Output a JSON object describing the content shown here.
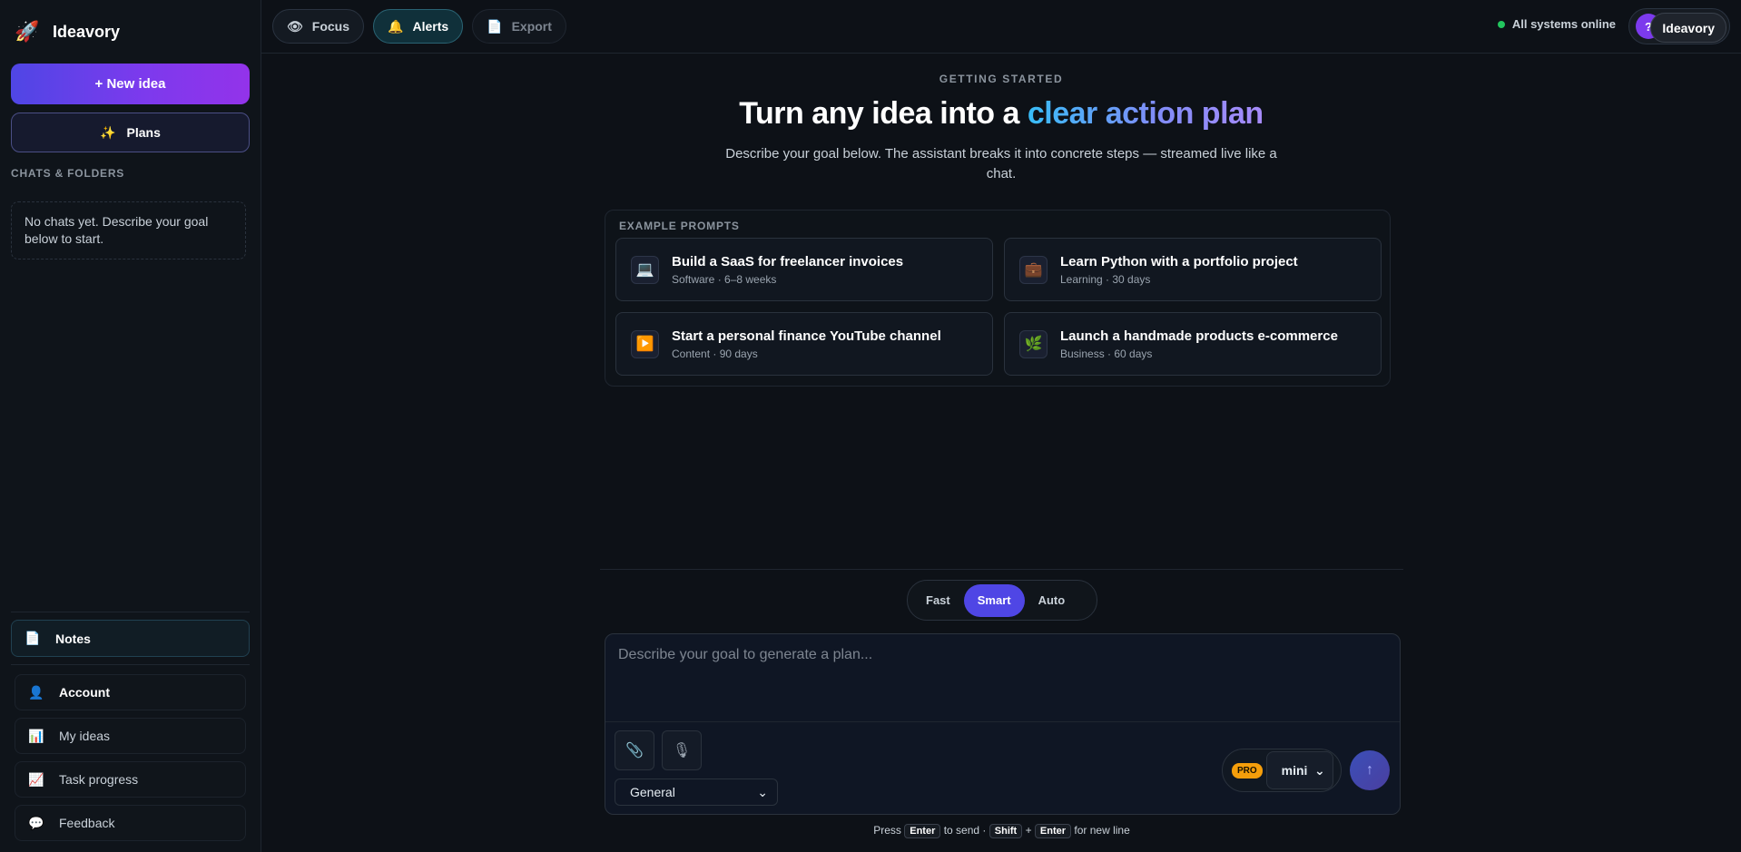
{
  "brand": {
    "name": "Ideavory",
    "icon": "rocket-icon"
  },
  "sidebar": {
    "new_idea_label": "+ New idea",
    "plans_label": "Plans",
    "plans_icon": "sparkles-icon",
    "section_label": "CHATS & FOLDERS",
    "empty_text": "No chats yet. Describe your goal below to start.",
    "notes_label": "Notes",
    "nav": [
      {
        "label": "Account",
        "icon": "person-icon"
      },
      {
        "label": "My ideas",
        "icon": "bar-chart-icon"
      },
      {
        "label": "Task progress",
        "icon": "trend-chart-icon"
      },
      {
        "label": "Feedback",
        "icon": "speech-bubble-icon"
      }
    ]
  },
  "topbar": {
    "focus_label": "Focus",
    "alerts_label": "Alerts",
    "export_label": "Export",
    "status_text": "All systems online",
    "status_color": "#22c55e",
    "help_glyph": "?",
    "tooltip_text": "Ideavory"
  },
  "hero": {
    "eyebrow": "GETTING STARTED",
    "title_plain": "Turn any idea into a ",
    "title_highlight": "clear action plan",
    "subtitle": "Describe your goal below. The assistant breaks it into concrete steps — streamed live like a chat."
  },
  "examples": {
    "label": "EXAMPLE PROMPTS",
    "items": [
      {
        "title": "Build a SaaS for freelancer invoices",
        "meta": "Software · 6–8 weeks",
        "icon": "laptop-icon"
      },
      {
        "title": "Learn Python with a portfolio project",
        "meta": "Learning · 30 days",
        "icon": "briefcase-icon"
      },
      {
        "title": "Start a personal finance YouTube channel",
        "meta": "Content · 90 days",
        "icon": "play-icon"
      },
      {
        "title": "Launch a handmade products e-commerce",
        "meta": "Business · 60 days",
        "icon": "leaf-icon"
      }
    ]
  },
  "composer": {
    "modes": [
      "Fast",
      "Smart",
      "Auto"
    ],
    "active_mode": "Smart",
    "placeholder": "Describe your goal to generate a plan...",
    "category_value": "General",
    "pro_badge": "PRO",
    "model_value": "mini",
    "hint": {
      "press": "Press",
      "enter": "Enter",
      "to_send": "to send ·",
      "shift": "Shift",
      "plus": "+",
      "enter2": "Enter",
      "new_line": "for new line"
    }
  }
}
